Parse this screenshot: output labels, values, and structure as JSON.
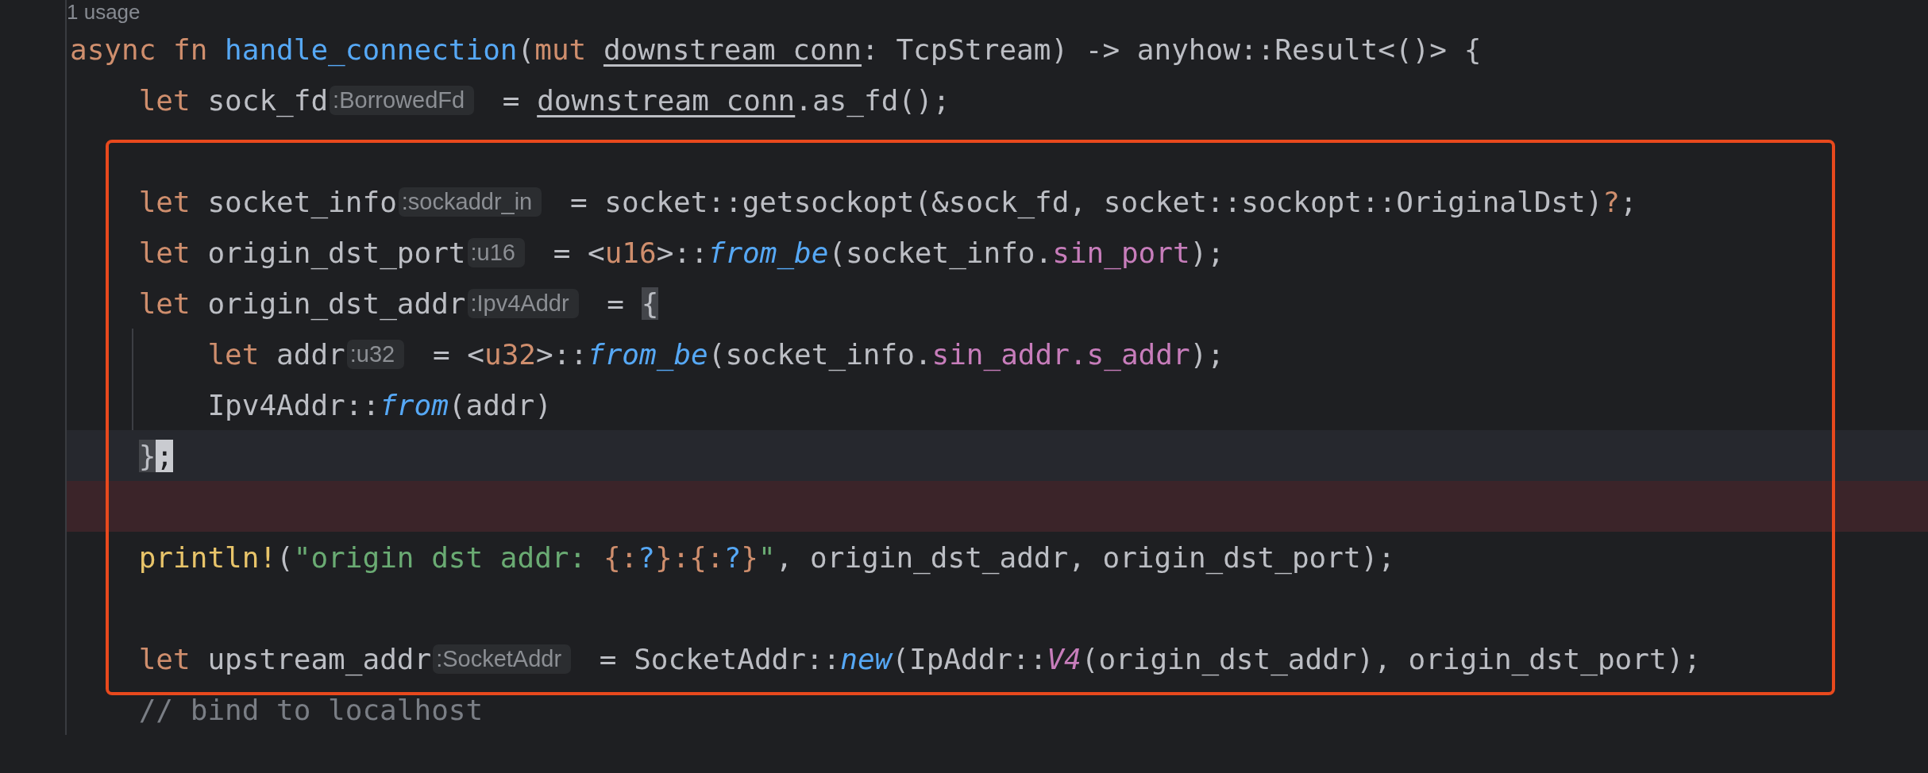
{
  "usage": "1 usage",
  "lines": [
    {
      "framed": false,
      "current": false,
      "error": false,
      "tokens": [
        {
          "kind": "kw",
          "text": "async fn "
        },
        {
          "kind": "fndecl",
          "text": "handle_connection"
        },
        {
          "kind": "plain",
          "text": "("
        },
        {
          "kind": "kw",
          "text": "mut "
        },
        {
          "kind": "param",
          "text": "downstream_conn"
        },
        {
          "kind": "plain",
          "text": ": TcpStream) -> anyhow::Result<()> {"
        }
      ],
      "children": [
        {
          "framed": false,
          "current": false,
          "error": false,
          "tokens": [
            {
              "kind": "kw",
              "text": "let "
            },
            {
              "kind": "plain",
              "text": "sock_fd"
            },
            {
              "kind": "hint",
              "text": ":BorrowedFd"
            },
            {
              "kind": "plain",
              "text": " = "
            },
            {
              "kind": "param",
              "text": "downstream_conn"
            },
            {
              "kind": "plain",
              "text": ".as_fd();"
            }
          ]
        },
        {
          "framed": true,
          "current": false,
          "error": false
        },
        {
          "framed": true,
          "current": false,
          "error": false,
          "tokens": [
            {
              "kind": "kw",
              "text": "let "
            },
            {
              "kind": "plain",
              "text": "socket_info"
            },
            {
              "kind": "hint",
              "text": ":sockaddr_in"
            },
            {
              "kind": "plain",
              "text": " = socket::getsockopt(&sock_fd, socket::sockopt::OriginalDst)"
            },
            {
              "kind": "op",
              "text": "?"
            },
            {
              "kind": "plain",
              "text": ";"
            }
          ]
        },
        {
          "framed": true,
          "current": false,
          "error": false,
          "tokens": [
            {
              "kind": "kw",
              "text": "let "
            },
            {
              "kind": "plain",
              "text": "origin_dst_port"
            },
            {
              "kind": "hint",
              "text": ":u16"
            },
            {
              "kind": "plain",
              "text": " = <"
            },
            {
              "kind": "kw",
              "text": "u16"
            },
            {
              "kind": "plain",
              "text": ">::"
            },
            {
              "kind": "call",
              "text": "from_be"
            },
            {
              "kind": "plain",
              "text": "(socket_info."
            },
            {
              "kind": "field",
              "text": "sin_port"
            },
            {
              "kind": "plain",
              "text": ");"
            }
          ]
        },
        {
          "framed": true,
          "current": false,
          "error": false,
          "tokens": [
            {
              "kind": "kw",
              "text": "let "
            },
            {
              "kind": "plain",
              "text": "origin_dst_addr"
            },
            {
              "kind": "hint",
              "text": ":Ipv4Addr"
            },
            {
              "kind": "plain",
              "text": " = "
            },
            {
              "kind": "match",
              "text": "{"
            }
          ],
          "children": [
            {
              "framed": true,
              "current": false,
              "error": false,
              "tokens": [
                {
                  "kind": "kw",
                  "text": "let "
                },
                {
                  "kind": "plain",
                  "text": "addr"
                },
                {
                  "kind": "hint",
                  "text": ":u32"
                },
                {
                  "kind": "plain",
                  "text": " = <"
                },
                {
                  "kind": "kw",
                  "text": "u32"
                },
                {
                  "kind": "plain",
                  "text": ">::"
                },
                {
                  "kind": "call",
                  "text": "from_be"
                },
                {
                  "kind": "plain",
                  "text": "(socket_info."
                },
                {
                  "kind": "field",
                  "text": "sin_addr.s_addr"
                },
                {
                  "kind": "plain",
                  "text": ");"
                }
              ]
            },
            {
              "framed": true,
              "current": false,
              "error": false,
              "tokens": [
                {
                  "kind": "plain",
                  "text": "Ipv4Addr::"
                },
                {
                  "kind": "call",
                  "text": "from"
                },
                {
                  "kind": "plain",
                  "text": "(addr)"
                }
              ]
            }
          ]
        },
        {
          "framed": true,
          "current": true,
          "error": false,
          "tokens": [
            {
              "kind": "match",
              "text": "}"
            },
            {
              "kind": "cursor",
              "text": ";"
            }
          ]
        },
        {
          "framed": true,
          "current": false,
          "error": true
        },
        {
          "framed": true,
          "current": false,
          "error": false,
          "tokens": [
            {
              "kind": "macro",
              "text": "println!"
            },
            {
              "kind": "plain",
              "text": "("
            },
            {
              "kind": "string",
              "text": "\"origin dst addr: "
            },
            {
              "kind": "fmt",
              "text": "{:"
            },
            {
              "kind": "fmtq",
              "text": "?"
            },
            {
              "kind": "fmt",
              "text": "}:{:"
            },
            {
              "kind": "fmtq",
              "text": "?"
            },
            {
              "kind": "fmt",
              "text": "}"
            },
            {
              "kind": "string",
              "text": "\""
            },
            {
              "kind": "plain",
              "text": ", origin_dst_addr, origin_dst_port);"
            }
          ]
        },
        {
          "framed": true,
          "current": false,
          "error": false
        },
        {
          "framed": true,
          "current": false,
          "error": false,
          "tokens": [
            {
              "kind": "kw",
              "text": "let "
            },
            {
              "kind": "plain",
              "text": "upstream_addr"
            },
            {
              "kind": "hint",
              "text": ":SocketAddr"
            },
            {
              "kind": "plain",
              "text": " = SocketAddr::"
            },
            {
              "kind": "call",
              "text": "new"
            },
            {
              "kind": "plain",
              "text": "(IpAddr::"
            },
            {
              "kind": "variant",
              "text": "V4"
            },
            {
              "kind": "plain",
              "text": "(origin_dst_addr), origin_dst_port);"
            }
          ]
        },
        {
          "framed": false,
          "current": false,
          "error": false,
          "tokens": [
            {
              "kind": "comment",
              "text": "// bind to localhost"
            }
          ]
        }
      ]
    }
  ]
}
